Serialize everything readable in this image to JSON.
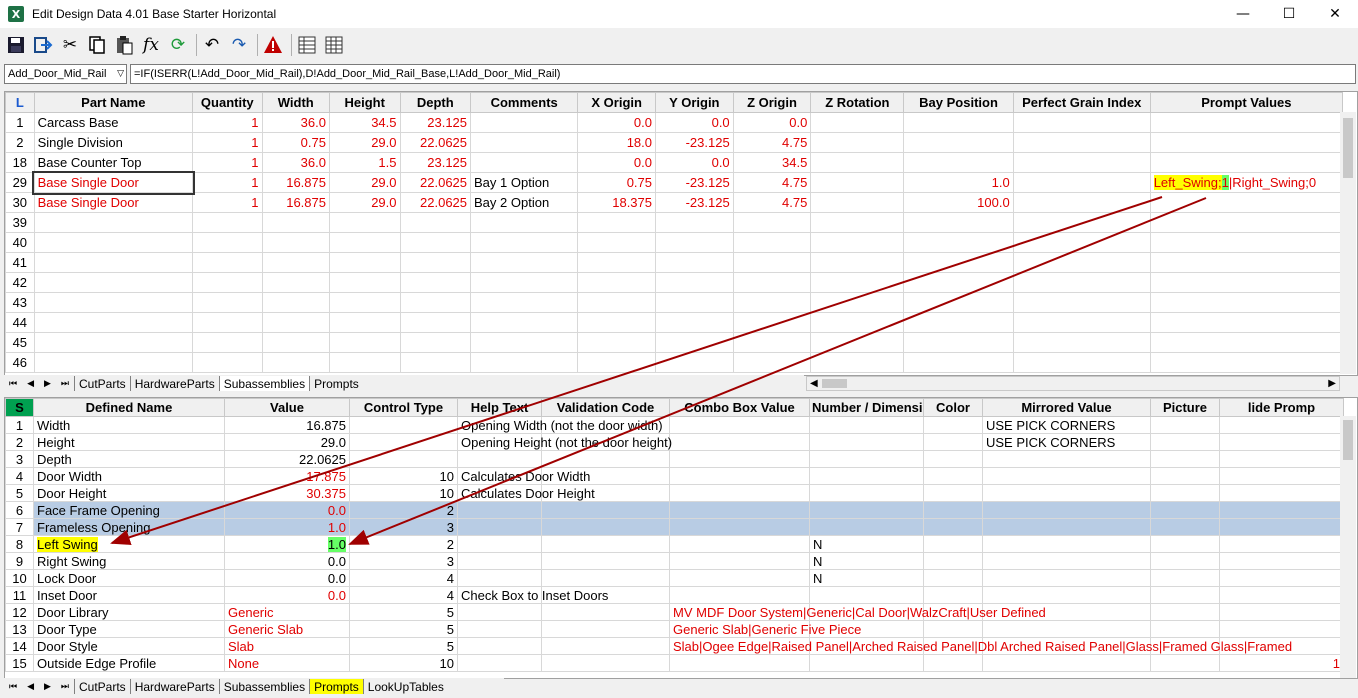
{
  "window": {
    "title": "Edit Design Data 4.01 Base Starter Horizontal",
    "app_icon": "X",
    "minimize": "—",
    "maximize": "☐",
    "close": "✕"
  },
  "toolbar": {
    "icons": [
      "save-icon",
      "export-icon",
      "cut-icon",
      "copy-icon",
      "paste-icon",
      "function-icon",
      "refresh-icon",
      "undo-icon",
      "redo-icon",
      "warning-icon",
      "grid-icon",
      "table-icon"
    ]
  },
  "formula_bar": {
    "name": "Add_Door_Mid_Rail",
    "formula": "=IF(ISERR(L!Add_Door_Mid_Rail),D!Add_Door_Mid_Rail_Base,L!Add_Door_Mid_Rail)"
  },
  "top_grid": {
    "corner": "L",
    "headers": [
      "Part Name",
      "Quantity",
      "Width",
      "Height",
      "Depth",
      "Comments",
      "X Origin",
      "Y Origin",
      "Z Origin",
      "Z Rotation",
      "Bay Position",
      "Perfect Grain Index",
      "Prompt Values"
    ],
    "rows": [
      {
        "n": "1",
        "name": "Carcass Base",
        "qty": "1",
        "w": "36.0",
        "h": "34.5",
        "d": "23.125",
        "c": "",
        "x": "0.0",
        "y": "0.0",
        "z": "0.0",
        "zr": "",
        "bay": "",
        "pg": "",
        "pv": ""
      },
      {
        "n": "2",
        "name": "Single Division",
        "qty": "1",
        "w": "0.75",
        "h": "29.0",
        "d": "22.0625",
        "c": "",
        "x": "18.0",
        "y": "-23.125",
        "z": "4.75",
        "zr": "",
        "bay": "",
        "pg": "",
        "pv": ""
      },
      {
        "n": "18",
        "name": "Base Counter Top",
        "qty": "1",
        "w": "36.0",
        "h": "1.5",
        "d": "23.125",
        "c": "",
        "x": "0.0",
        "y": "0.0",
        "z": "34.5",
        "zr": "",
        "bay": "",
        "pg": "",
        "pv": ""
      },
      {
        "n": "29",
        "name": "Base Single Door",
        "qty": "1",
        "w": "16.875",
        "h": "29.0",
        "d": "22.0625",
        "c": "Bay 1 Option",
        "x": "0.75",
        "y": "-23.125",
        "z": "4.75",
        "zr": "",
        "bay": "1.0",
        "pg": "",
        "pv": ""
      },
      {
        "n": "30",
        "name": "Base Single Door",
        "qty": "1",
        "w": "16.875",
        "h": "29.0",
        "d": "22.0625",
        "c": "Bay 2 Option",
        "x": "18.375",
        "y": "-23.125",
        "z": "4.75",
        "zr": "",
        "bay": "100.0",
        "pg": "",
        "pv": ""
      },
      {
        "n": "39"
      },
      {
        "n": "40"
      },
      {
        "n": "41"
      },
      {
        "n": "42"
      },
      {
        "n": "43"
      },
      {
        "n": "44"
      },
      {
        "n": "45"
      },
      {
        "n": "46"
      }
    ],
    "prompt_value_parts": {
      "a": "Left_Swing",
      "sep1": ";",
      "b": "1",
      "rest": "|Right_Swing;0"
    }
  },
  "top_tabs": [
    "CutParts",
    "HardwareParts",
    "Subassemblies",
    "Prompts"
  ],
  "bottom_grid": {
    "corner": "S",
    "headers": [
      "Defined Name",
      "Value",
      "Control Type",
      "Help Text",
      "Validation Code",
      "Combo Box Value",
      "Number / Dimension",
      "Color",
      "Mirrored Value",
      "Picture",
      "lide Promp"
    ],
    "rows": [
      {
        "n": "1",
        "name": "Width",
        "val": "16.875",
        "ct": "",
        "help": "Opening Width (not the door width)",
        "combo": "",
        "nd": "",
        "mir": "USE PICK CORNERS"
      },
      {
        "n": "2",
        "name": "Height",
        "val": "29.0",
        "ct": "",
        "help": "Opening Height (not the door height)",
        "combo": "",
        "nd": "",
        "mir": "USE PICK CORNERS"
      },
      {
        "n": "3",
        "name": "Depth",
        "val": "22.0625",
        "ct": "",
        "help": "",
        "combo": "",
        "nd": "",
        "mir": ""
      },
      {
        "n": "4",
        "name": "Door Width",
        "val": "17.875",
        "ct": "10",
        "help": "Calculates Door Width",
        "combo": "",
        "nd": "",
        "mir": ""
      },
      {
        "n": "5",
        "name": "Door Height",
        "val": "30.375",
        "ct": "10",
        "help": "Calculates Door Height",
        "combo": "",
        "nd": "",
        "mir": ""
      },
      {
        "n": "6",
        "name": "Face Frame Opening",
        "val": "0.0",
        "ct": "2",
        "help": "",
        "combo": "",
        "nd": "",
        "mir": ""
      },
      {
        "n": "7",
        "name": "Frameless Opening",
        "val": "1.0",
        "ct": "3",
        "help": "",
        "combo": "",
        "nd": "",
        "mir": ""
      },
      {
        "n": "8",
        "name": "Left Swing",
        "val": "1.0",
        "ct": "2",
        "help": "",
        "combo": "",
        "nd": "N",
        "mir": ""
      },
      {
        "n": "9",
        "name": "Right Swing",
        "val": "0.0",
        "ct": "3",
        "help": "",
        "combo": "",
        "nd": "N",
        "mir": ""
      },
      {
        "n": "10",
        "name": "Lock Door",
        "val": "0.0",
        "ct": "4",
        "help": "",
        "combo": "",
        "nd": "N",
        "mir": ""
      },
      {
        "n": "11",
        "name": "Inset Door",
        "val": "0.0",
        "ct": "4",
        "help": "Check Box to Inset Doors",
        "combo": "",
        "nd": "",
        "mir": ""
      },
      {
        "n": "12",
        "name": "Door Library",
        "val": "Generic",
        "ct": "5",
        "help": "",
        "combo": "MV MDF Door System|Generic|Cal Door|WalzCraft|User Defined",
        "nd": "",
        "mir": ""
      },
      {
        "n": "13",
        "name": "Door Type",
        "val": "Generic Slab",
        "ct": "5",
        "help": "",
        "combo": "Generic Slab|Generic Five Piece",
        "nd": "",
        "mir": ""
      },
      {
        "n": "14",
        "name": "Door Style",
        "val": "Slab",
        "ct": "5",
        "help": "",
        "combo": "Slab|Ogee Edge|Raised Panel|Arched Raised Panel|Dbl Arched Raised Panel|Glass|Framed Glass|Framed",
        "nd": "",
        "mir": ""
      },
      {
        "n": "15",
        "name": "Outside Edge Profile",
        "val": "None",
        "ct": "10",
        "help": "",
        "combo": "",
        "nd": "",
        "mir": "",
        "last": "1"
      }
    ]
  },
  "bottom_tabs": [
    "CutParts",
    "HardwareParts",
    "Subassemblies",
    "Prompts",
    "LookUpTables"
  ]
}
